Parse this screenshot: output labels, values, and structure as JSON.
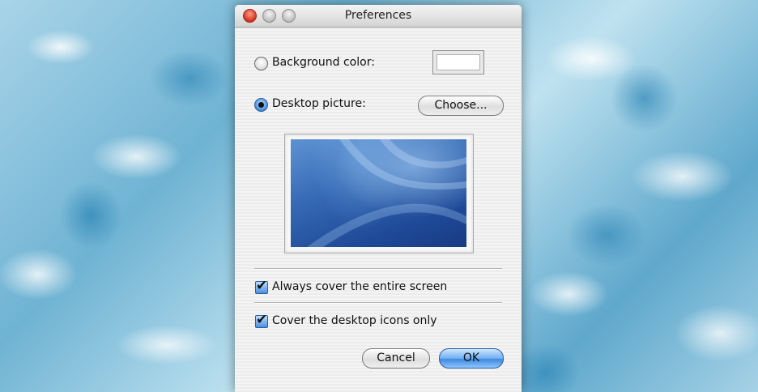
{
  "window": {
    "title": "Preferences"
  },
  "background_color": {
    "label": "Background color:",
    "selected": false,
    "swatch_color": "#ffffff"
  },
  "desktop_picture": {
    "label": "Desktop picture:",
    "selected": true,
    "choose_label": "Choose..."
  },
  "options": {
    "cover_screen_label": "Always cover the entire screen",
    "cover_screen_checked": true,
    "cover_icons_label": "Cover the desktop icons only",
    "cover_icons_checked": true
  },
  "buttons": {
    "cancel_label": "Cancel",
    "ok_label": "OK"
  },
  "icons": {
    "checkmark": "✔"
  },
  "colors": {
    "default_button": "#3f88e0",
    "close_button": "#d2321d"
  }
}
